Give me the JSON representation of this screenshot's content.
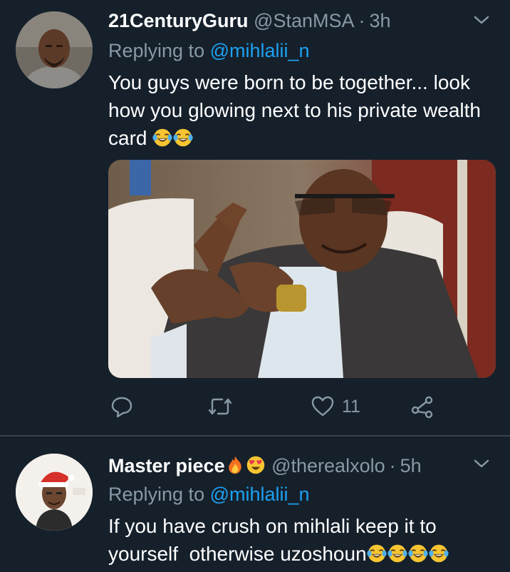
{
  "tweets": [
    {
      "author": {
        "name": "21CenturyGuru",
        "handle": "@StanMSA"
      },
      "separator": "·",
      "time": "3h",
      "replying_prefix": "Replying to",
      "replying_to": "@mihlalii_n",
      "text": "You guys were born to be together... look how you glowing next to his private wealth card",
      "text_emojis": [
        "face-with-tears-of-joy",
        "face-with-tears-of-joy"
      ],
      "actions": {
        "reply_count": "",
        "retweet_count": "",
        "like_count": "11"
      }
    },
    {
      "author": {
        "name": "Master piece",
        "handle": "@therealxolo",
        "name_emojis": [
          "fire",
          "smiling-face-with-heart-eyes"
        ]
      },
      "separator": "·",
      "time": "5h",
      "replying_prefix": "Replying to",
      "replying_to": "@mihlalii_n",
      "text": "If you have crush on mihlali keep it to yourself  otherwise uzoshoun",
      "text_emojis": [
        "face-with-tears-of-joy",
        "face-with-tears-of-joy",
        "face-with-tears-of-joy",
        "face-with-tears-of-joy"
      ]
    }
  ],
  "colors": {
    "background": "#15202b",
    "divider": "#38444d",
    "text_primary": "#ffffff",
    "text_secondary": "#8899a6",
    "link": "#1da1f2"
  },
  "icons": [
    "chevron-down-icon",
    "reply-icon",
    "retweet-icon",
    "like-icon",
    "share-icon"
  ]
}
